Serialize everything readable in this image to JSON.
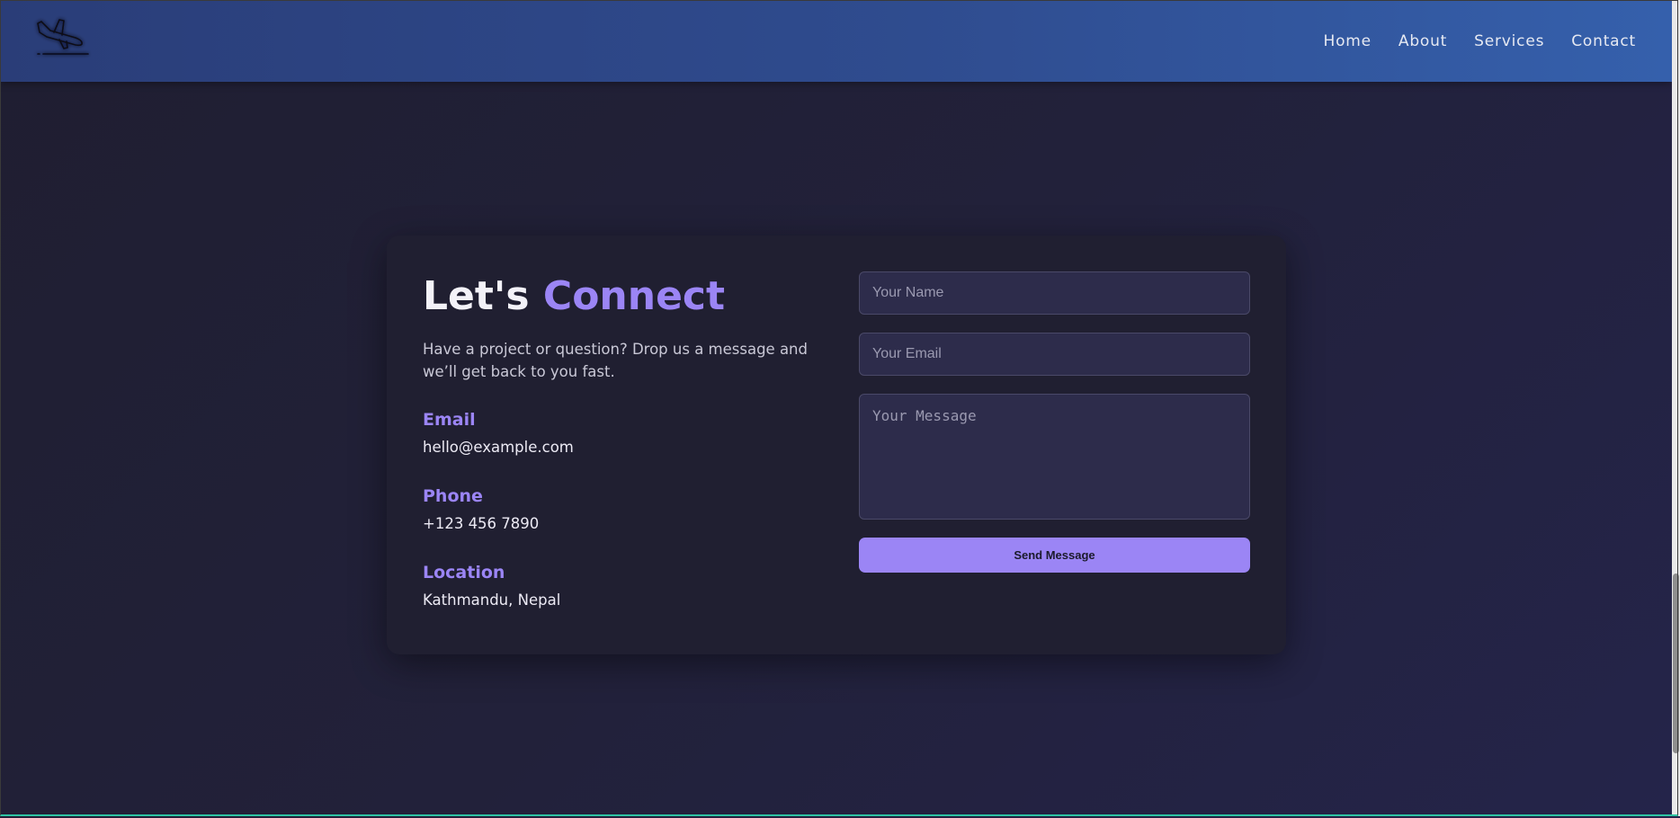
{
  "nav": {
    "items": [
      {
        "label": "Home"
      },
      {
        "label": "About"
      },
      {
        "label": "Services"
      },
      {
        "label": "Contact"
      }
    ]
  },
  "contact": {
    "heading_plain": "Let's",
    "heading_accent": "Connect",
    "intro": "Have a project or question? Drop us a message and we’ll get back to you fast.",
    "email_label": "Email",
    "email_value": "hello@example.com",
    "phone_label": "Phone",
    "phone_value": "+123 456 7890",
    "location_label": "Location",
    "location_value": "Kathmandu, Nepal"
  },
  "form": {
    "name_placeholder": "Your Name",
    "email_placeholder": "Your Email",
    "message_placeholder": "Your Message",
    "submit_label": "Send Message"
  },
  "colors": {
    "accent": "#9b85f5",
    "header_start": "#2a3d78",
    "header_end": "#3560ac",
    "background": "#201f31"
  }
}
